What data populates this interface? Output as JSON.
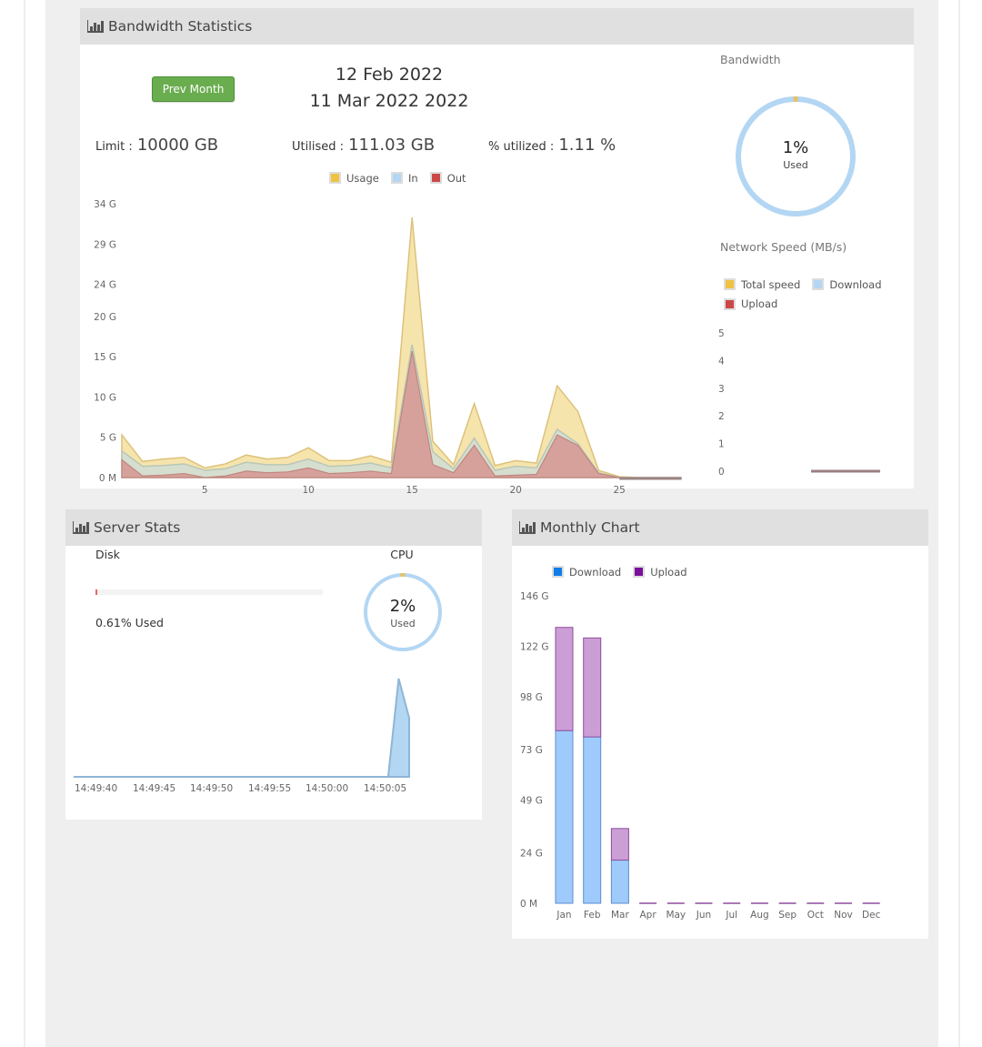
{
  "bandwidth_panel": {
    "title": "Bandwidth Statistics",
    "prev_month_label": "Prev Month",
    "date_from": "12 Feb 2022",
    "date_to": "11 Mar 2022 2022",
    "limit_label": "Limit :",
    "limit_value": "10000 GB",
    "utilised_label": "Utilised :",
    "utilised_value": "111.03 GB",
    "percent_label": "% utilized :",
    "percent_value": "1.11 %",
    "donut": {
      "title": "Bandwidth",
      "percent_text": "1%",
      "sub": "Used",
      "used_fraction": 0.0111
    },
    "network": {
      "title": "Network Speed (MB/s)"
    }
  },
  "server_panel": {
    "title": "Server Stats",
    "disk_label": "Disk",
    "disk_used_text": "0.61% Used",
    "disk_used_percent": 0.61,
    "cpu_label": "CPU",
    "cpu_percent_text": "2%",
    "cpu_sub": "Used",
    "cpu_used_fraction": 0.02
  },
  "monthly_panel": {
    "title": "Monthly Chart"
  },
  "colors": {
    "usage": "#f0c242",
    "in": "#b3d6f3",
    "out": "#cc4848",
    "download": "#0f7ee8",
    "upload": "#7a0f9a",
    "button": "#6aad4f",
    "header_bg": "#e0e0e0",
    "ring": "#b3d6f3"
  },
  "chart_data": [
    {
      "type": "area",
      "title": "Bandwidth Statistics",
      "legend": [
        "Usage",
        "In",
        "Out"
      ],
      "legend_placement": "top-center",
      "x": [
        1,
        2,
        3,
        4,
        5,
        6,
        7,
        8,
        9,
        10,
        11,
        12,
        13,
        14,
        15,
        16,
        17,
        18,
        19,
        20,
        21,
        22,
        23,
        24,
        25,
        26,
        27,
        28
      ],
      "xticks": [
        "5",
        "10",
        "15",
        "20",
        "25"
      ],
      "xtick_values": [
        5,
        10,
        15,
        20,
        25
      ],
      "yticks": [
        "0 M",
        "5 G",
        "10 G",
        "15 G",
        "20 G",
        "24 G",
        "29 G",
        "34 G"
      ],
      "ylim": [
        0,
        34
      ],
      "yunit": "G",
      "series": [
        {
          "name": "Usage",
          "values": [
            5.3,
            2.0,
            2.3,
            2.5,
            1.2,
            1.7,
            2.8,
            2.3,
            2.5,
            3.7,
            2.1,
            2.1,
            2.7,
            1.9,
            32.3,
            4.5,
            1.6,
            9.2,
            1.5,
            2.1,
            1.8,
            11.4,
            8.2,
            0.9,
            0.1,
            0,
            0,
            0
          ]
        },
        {
          "name": "In",
          "values": [
            1.1,
            1.2,
            1.2,
            1.2,
            0.9,
            0.9,
            1.1,
            1.0,
            0.9,
            1.1,
            0.9,
            0.9,
            1.0,
            0.7,
            0.8,
            1.6,
            0.5,
            0.9,
            0.7,
            1.1,
            0.8,
            0.7,
            0.2,
            0.1,
            0,
            0,
            0,
            0
          ]
        },
        {
          "name": "Out",
          "values": [
            2.2,
            0.2,
            0.3,
            0.5,
            0.0,
            0.2,
            0.8,
            0.6,
            0.7,
            1.2,
            0.5,
            0.6,
            0.8,
            0.5,
            15.7,
            1.6,
            0.6,
            4.0,
            0.2,
            0.3,
            0.4,
            5.3,
            4.0,
            0.5,
            0,
            0,
            0,
            0
          ]
        }
      ]
    },
    {
      "type": "line",
      "title": "Network Speed (MB/s)",
      "legend": [
        "Total speed",
        "Download",
        "Upload"
      ],
      "legend_placement": "top-left",
      "yticks": [
        "0",
        "1",
        "2",
        "3",
        "4",
        "5"
      ],
      "ylim": [
        0,
        5
      ],
      "series": [
        {
          "name": "Total speed",
          "values": [
            0,
            0,
            0,
            0,
            0,
            0,
            0,
            0,
            0,
            0
          ]
        },
        {
          "name": "Download",
          "values": [
            0,
            0,
            0,
            0,
            0,
            0,
            0,
            0,
            0,
            0
          ]
        },
        {
          "name": "Upload",
          "values": [
            0,
            0,
            0,
            0,
            0,
            0,
            0,
            0,
            0,
            0
          ]
        }
      ]
    },
    {
      "type": "area",
      "title": "CPU",
      "xticks": [
        "14:49:40",
        "14:49:45",
        "14:49:50",
        "14:49:55",
        "14:50:00",
        "14:50:05"
      ],
      "series": [
        {
          "name": "CPU",
          "values": [
            0,
            0,
            0,
            0,
            0,
            0,
            0,
            0,
            0,
            0,
            0,
            0,
            0,
            0,
            0,
            0,
            0,
            0,
            0,
            0,
            0,
            0,
            0,
            0,
            0,
            0,
            0,
            0,
            0,
            0,
            0.0,
            1.0,
            0.6
          ]
        }
      ]
    },
    {
      "type": "bar",
      "title": "Monthly Chart",
      "stacked": true,
      "legend": [
        "Download",
        "Upload"
      ],
      "legend_placement": "top-left",
      "categories": [
        "Jan",
        "Feb",
        "Mar",
        "Apr",
        "May",
        "Jun",
        "Jul",
        "Aug",
        "Sep",
        "Oct",
        "Nov",
        "Dec"
      ],
      "yticks": [
        "0 M",
        "24 G",
        "49 G",
        "73 G",
        "98 G",
        "122 G",
        "146 G"
      ],
      "ylim": [
        0,
        146
      ],
      "yunit": "G",
      "series": [
        {
          "name": "Download",
          "values": [
            82,
            79,
            20.5,
            0,
            0,
            0,
            0,
            0,
            0,
            0,
            0,
            0
          ]
        },
        {
          "name": "Upload",
          "values": [
            49,
            47,
            15,
            0,
            0,
            0,
            0,
            0,
            0,
            0,
            0,
            0
          ]
        }
      ]
    }
  ]
}
